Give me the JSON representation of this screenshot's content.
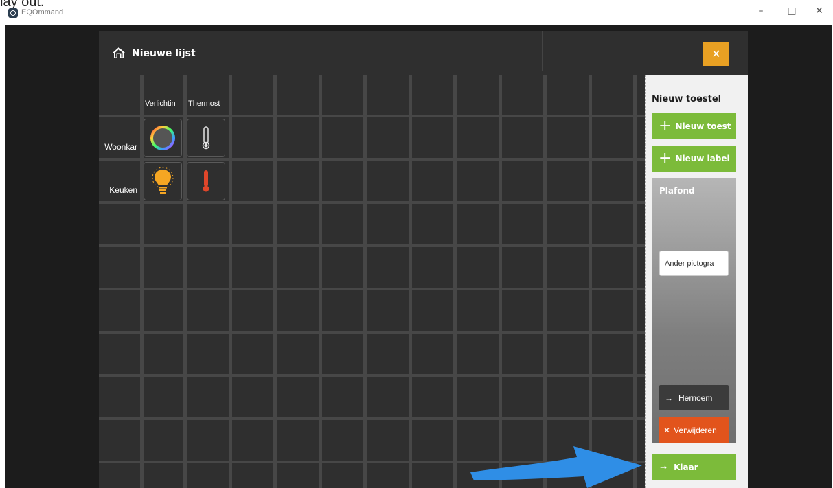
{
  "crop_caption": "lay out.",
  "window": {
    "title": "EQOmmand",
    "minimize_glyph": "–",
    "maximize_glyph": "□",
    "close_glyph": "✕"
  },
  "header": {
    "title": "Nieuwe lijst",
    "home_icon": "home-icon",
    "close_glyph": "✕",
    "close_color": "#e8a023"
  },
  "grid": {
    "columns": [
      "Verlichtin",
      "Thermost"
    ],
    "rows": [
      "Woonkar",
      "Keuken"
    ],
    "tiles": [
      {
        "row": 0,
        "col": 0,
        "icon": "rgb-ring-icon"
      },
      {
        "row": 0,
        "col": 1,
        "icon": "thermometer-white-icon"
      },
      {
        "row": 1,
        "col": 0,
        "icon": "lightbulb-icon"
      },
      {
        "row": 1,
        "col": 1,
        "icon": "thermometer-red-icon"
      }
    ]
  },
  "sidebar": {
    "title": "Nieuw toestel",
    "new_device_label": "Nieuw toest",
    "new_label_label": "Nieuw label",
    "card": {
      "title": "Plafond",
      "other_icon_label": "Ander pictogra",
      "rename_label": "Hernoem",
      "delete_label": "Verwijderen"
    },
    "done_label": "Klaar",
    "accent_green": "#7cbb3a",
    "danger_orange": "#e2541c"
  },
  "annotation": {
    "arrow_color": "#2f8ee6",
    "arrow_icon": "pointer-arrow-icon"
  }
}
